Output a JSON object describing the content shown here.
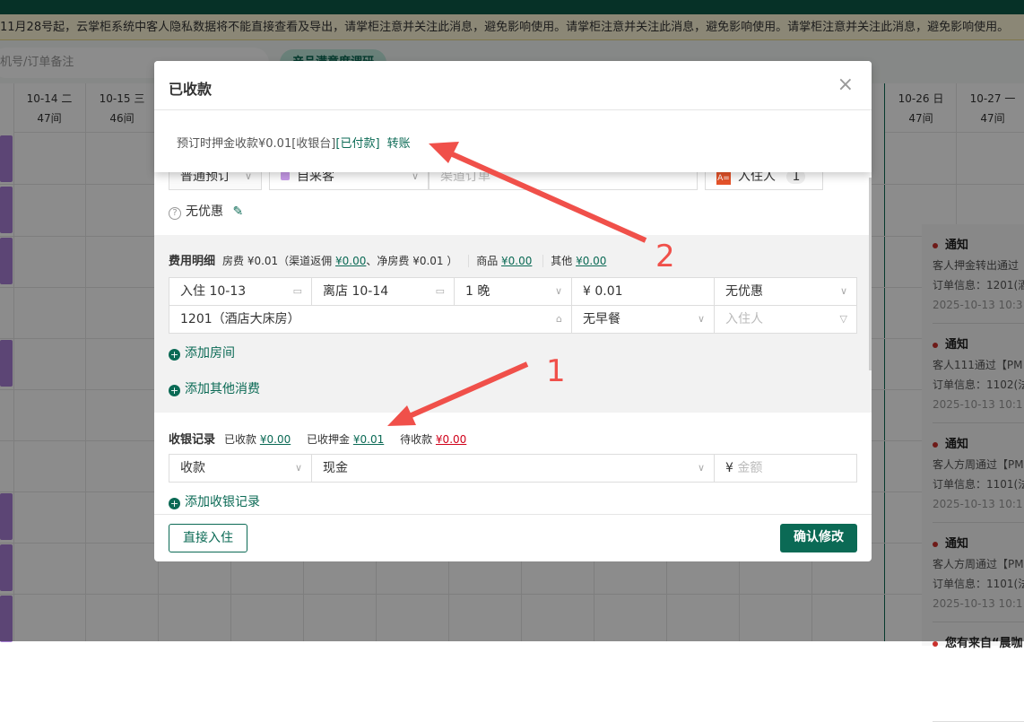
{
  "notice": "11月28号起，云掌柜系统中客人隐私数据将不能直接查看及导出，请掌柜注意并关注此消息，避免影响使用。请掌柜注意并关注此消息，避免影响使用。请掌柜注意并关注此消息，避免影响使用。",
  "search_placeholder": "机号/订单备注",
  "survey_label": "产品满意度调研",
  "calendar": [
    {
      "date": "10-14 二",
      "count": "47间"
    },
    {
      "date": "10-15 三",
      "count": "46间"
    },
    {
      "date": "10-26 日",
      "count": "47间"
    },
    {
      "date": "10-27 一",
      "count": "47间"
    }
  ],
  "notifications": [
    {
      "title": "通知",
      "line1": "客人押金转出通过",
      "line2": "订单信息：1201(酒",
      "time": "2025-10-13 10:3"
    },
    {
      "title": "通知",
      "line1": "客人111通过【PM",
      "line2": "订单信息：1102(法",
      "time": "2025-10-13 10:1"
    },
    {
      "title": "通知",
      "line1": "客人方周通过【PM",
      "line2": "订单信息：1101(法",
      "time": "2025-10-13 10:1"
    },
    {
      "title": "通知",
      "line1": "客人方周通过【PM",
      "line2": "订单信息：1101(法",
      "time": "2025-10-13 10:1"
    },
    {
      "title": "您有来自“晨咖"
    }
  ],
  "popup": {
    "title": "已收款",
    "close": "×",
    "text": "预订时押金收款¥0.01[收银台]",
    "status": "[已付款]",
    "transfer": "转账"
  },
  "order": {
    "type": "普通预订",
    "source": "自来客",
    "channel_placeholder": "渠道订单",
    "guest_label": "入住人",
    "guest_count": "1",
    "discount": "无优惠",
    "fee": {
      "title": "费用明细",
      "room": "房费 ¥0.01（渠道返佣",
      "commission": "¥0.00",
      "net": "、净房费 ¥0.01 ）",
      "goods_label": "商品",
      "goods": "¥0.00",
      "other_label": "其他",
      "other": "¥0.00"
    },
    "room": {
      "checkin": "入住 10-13",
      "checkout": "离店 10-14",
      "nights": "1 晚",
      "price": "¥ 0.01",
      "discount": "无优惠",
      "room": "1201（酒店大床房）",
      "breakfast": "无早餐",
      "guest_placeholder": "入住人"
    },
    "add_room": "添加房间",
    "add_other": "添加其他消费",
    "cashier": {
      "title": "收银记录",
      "received_label": "已收款",
      "received": "¥0.00",
      "deposit_label": "已收押金",
      "deposit": "¥0.01",
      "pending_label": "待收款",
      "pending": "¥0.00",
      "kind": "收款",
      "method": "现金",
      "amount_placeholder": "金额",
      "yen": "¥"
    },
    "add_cashier": "添加收银记录",
    "checkin_btn": "直接入住",
    "confirm_btn": "确认修改"
  },
  "annotations": {
    "one": "1",
    "two": "2"
  },
  "colors": {
    "brand": "#0b6a55",
    "arrow": "#f0504a"
  }
}
